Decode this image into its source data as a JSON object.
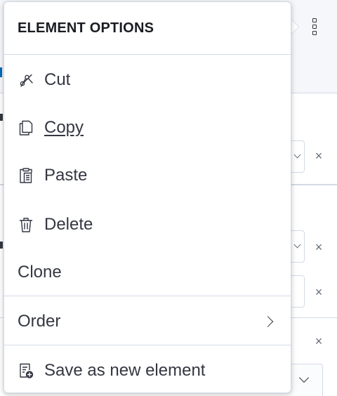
{
  "popover": {
    "title": "ELEMENT OPTIONS",
    "items": [
      {
        "label": "Cut",
        "icon": "scissors-icon"
      },
      {
        "label": "Copy",
        "icon": "copy-icon"
      },
      {
        "label": "Paste",
        "icon": "paste-icon"
      },
      {
        "label": "Delete",
        "icon": "trash-icon"
      },
      {
        "label": "Clone",
        "icon": ""
      }
    ],
    "order": {
      "label": "Order",
      "icon": "chevron-right-icon"
    },
    "save": {
      "label": "Save as new element",
      "icon": "save-element-icon"
    }
  },
  "background": {
    "actions_icon": "kebab-menu-icon",
    "close_glyph": "×"
  },
  "colors": {
    "text": "#343741",
    "title": "#1a1c21",
    "border": "#d3dae6",
    "background_band": "#f5f7fa",
    "link_accent": "#006bb8"
  }
}
